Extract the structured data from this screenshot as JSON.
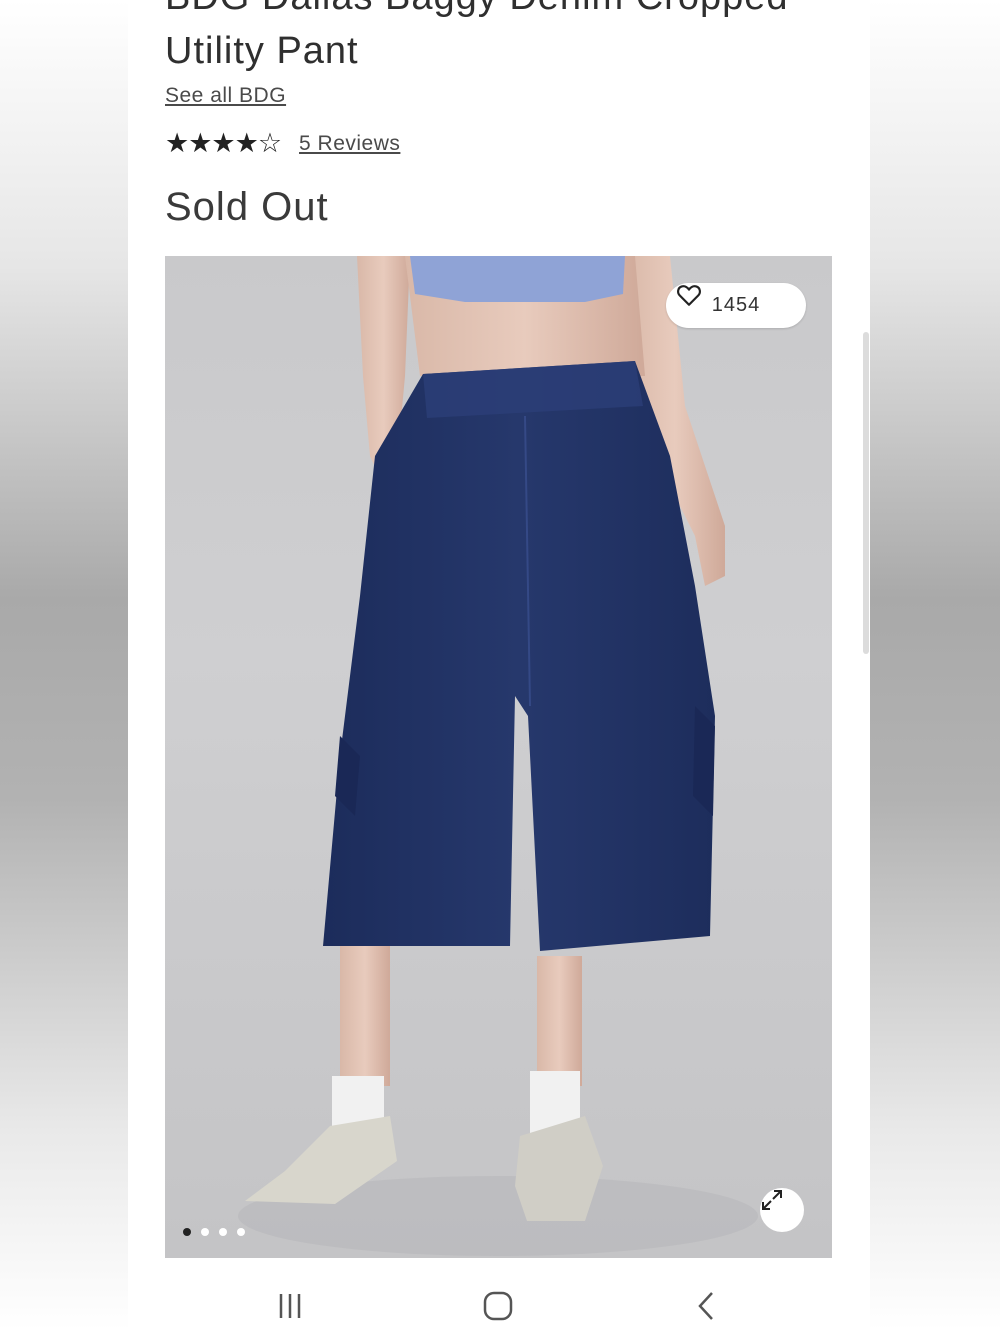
{
  "product": {
    "title": "BDG Dallas Baggy Denim Cropped Utility Pant",
    "see_all_link": "See all BDG",
    "rating_stars": "★★★★☆",
    "rating_value": 4,
    "rating_max": 5,
    "reviews_link": "5 Reviews",
    "availability": "Sold Out"
  },
  "gallery": {
    "like_count": "1454",
    "like_icon": "heart-outline-icon",
    "expand_icon": "expand-arrows-icon",
    "image_count": 4,
    "active_index": 0
  },
  "system_nav": {
    "recents_icon": "recents-icon",
    "home_icon": "home-icon",
    "back_icon": "back-chevron-icon"
  },
  "colors": {
    "denim": "#223466",
    "top": "#8fa3d6",
    "text": "#2f2f2f"
  }
}
